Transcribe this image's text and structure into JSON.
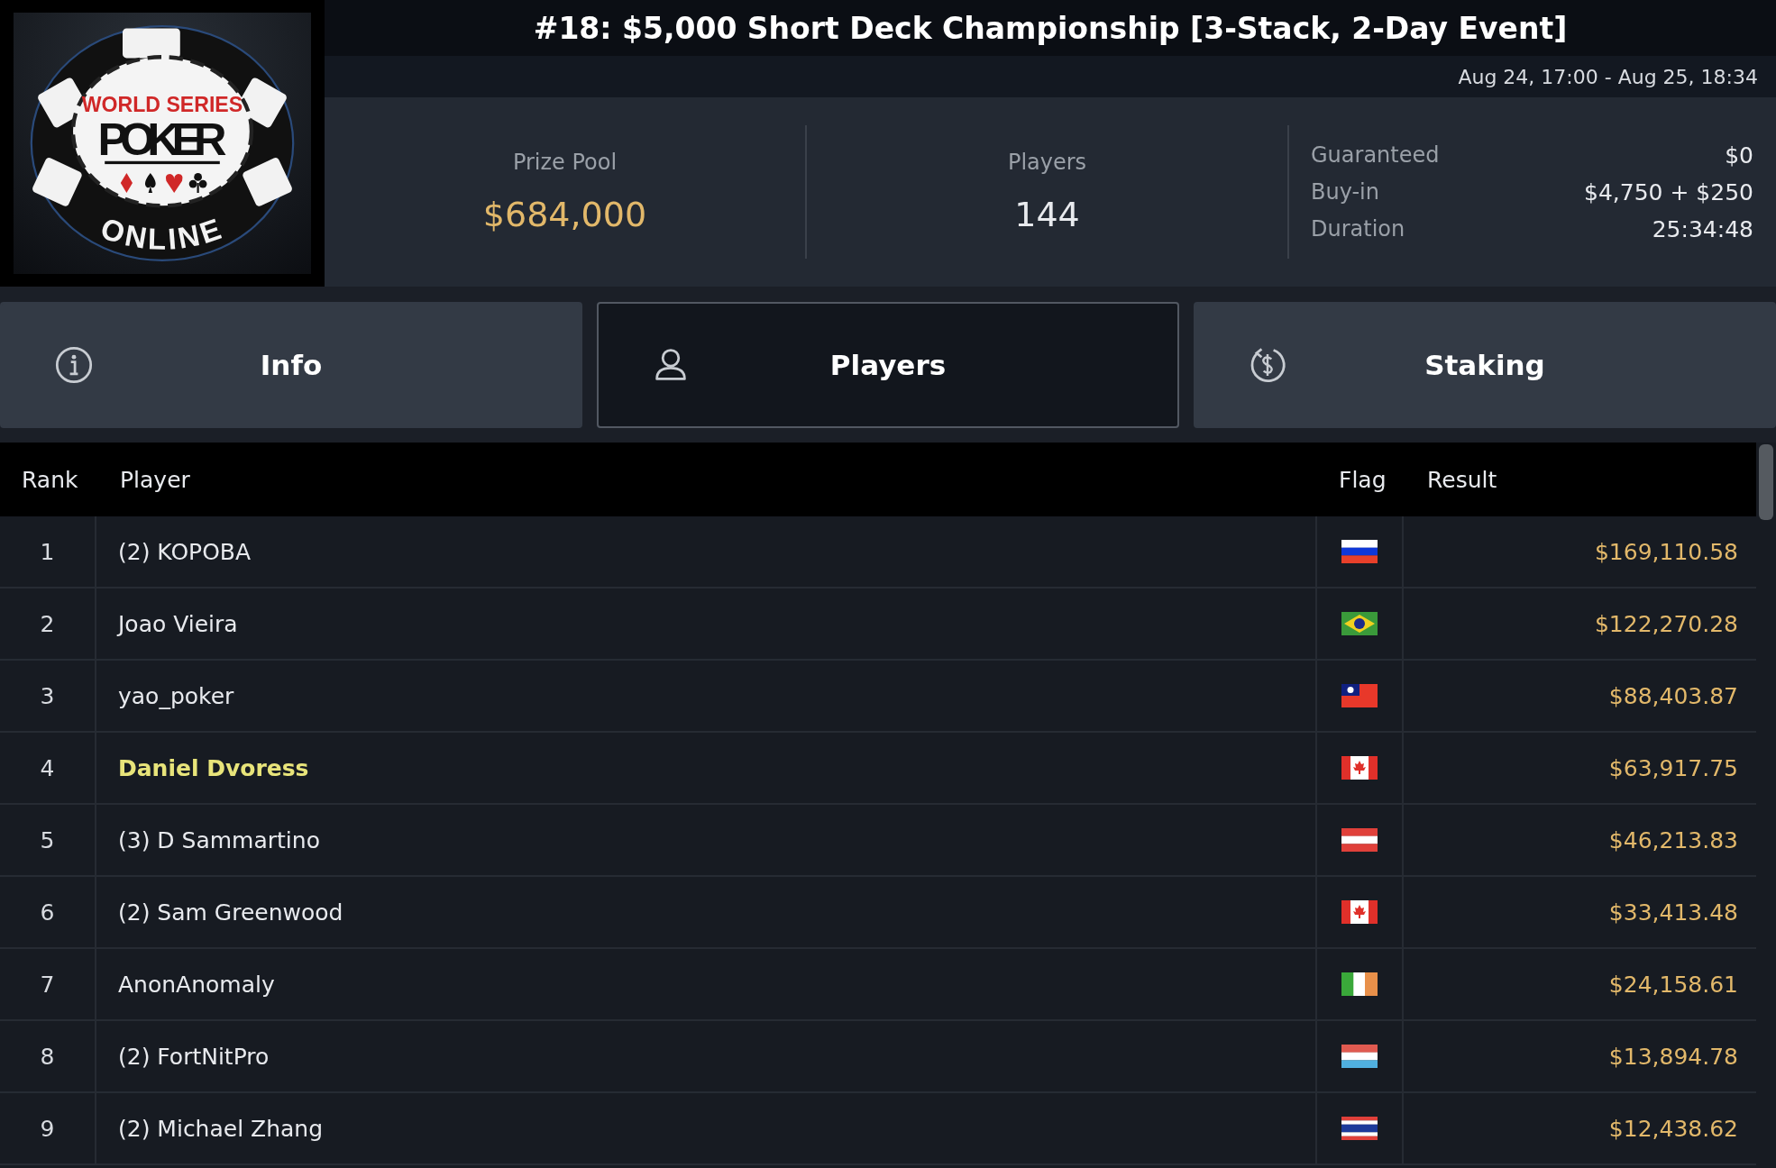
{
  "logo": {
    "top": "WORLD SERIES",
    "middle": "POKER",
    "bottom": "ONLINE"
  },
  "title": "#18: $5,000 Short Deck Championship [3-Stack, 2-Day Event]",
  "dates": "Aug 24, 17:00 - Aug 25, 18:34",
  "prize_pool": {
    "label": "Prize Pool",
    "value": "$684,000"
  },
  "players": {
    "label": "Players",
    "value": "144"
  },
  "details": [
    {
      "label": "Guaranteed",
      "value": "$0"
    },
    {
      "label": "Buy-in",
      "value": "$4,750 + $250"
    },
    {
      "label": "Duration",
      "value": "25:34:48"
    }
  ],
  "tabs": [
    {
      "label": "Info",
      "kind": "info",
      "selected": false
    },
    {
      "label": "Players",
      "kind": "person",
      "selected": true
    },
    {
      "label": "Staking",
      "kind": "staking",
      "selected": false
    }
  ],
  "table": {
    "columns": [
      "Rank",
      "Player",
      "Flag",
      "Result"
    ],
    "rows": [
      {
        "rank": "1",
        "player": "(2) KOPOBA",
        "kind": "ru",
        "result": "$169,110.58",
        "highlighted": false
      },
      {
        "rank": "2",
        "player": "Joao Vieira",
        "kind": "br",
        "result": "$122,270.28",
        "highlighted": false
      },
      {
        "rank": "3",
        "player": "yao_poker",
        "kind": "tw",
        "result": "$88,403.87",
        "highlighted": false
      },
      {
        "rank": "4",
        "player": "Daniel Dvoress",
        "kind": "ca",
        "result": "$63,917.75",
        "highlighted": true
      },
      {
        "rank": "5",
        "player": "(3) D Sammartino",
        "kind": "at",
        "result": "$46,213.83",
        "highlighted": false
      },
      {
        "rank": "6",
        "player": "(2) Sam Greenwood",
        "kind": "ca",
        "result": "$33,413.48",
        "highlighted": false
      },
      {
        "rank": "7",
        "player": "AnonAnomaly",
        "kind": "ie",
        "result": "$24,158.61",
        "highlighted": false
      },
      {
        "rank": "8",
        "player": "(2) FortNitPro",
        "kind": "lu",
        "result": "$13,894.78",
        "highlighted": false
      },
      {
        "rank": "9",
        "player": "(2) Michael Zhang",
        "kind": "th",
        "result": "$12,438.62",
        "highlighted": false
      }
    ]
  }
}
